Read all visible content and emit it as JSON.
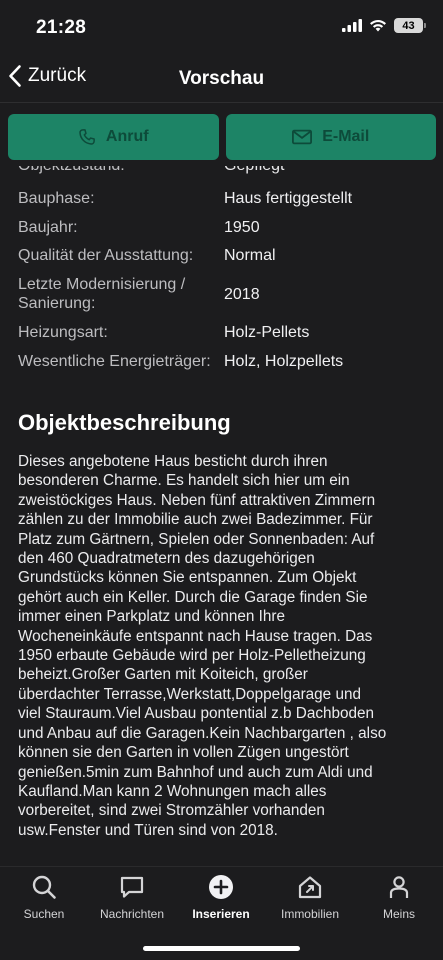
{
  "status": {
    "time": "21:28",
    "battery": "43"
  },
  "nav": {
    "back_label": "Zurück",
    "title": "Vorschau"
  },
  "actions": {
    "call_label": "Anruf",
    "email_label": "E-Mail"
  },
  "details_partial": {
    "label": "Objektzustand:",
    "value": "Gepflegt"
  },
  "details": [
    {
      "label": "Bauphase:",
      "value": "Haus fertiggestellt"
    },
    {
      "label": "Baujahr:",
      "value": "1950"
    },
    {
      "label": "Qualität der Ausstattung:",
      "value": "Normal"
    },
    {
      "label_line1": "Letzte Modernisierung /",
      "label_line2": "Sanierung:",
      "value": "2018"
    },
    {
      "label": "Heizungsart:",
      "value": "Holz-Pellets"
    },
    {
      "label": "Wesentliche Energieträger:",
      "value": "Holz, Holzpellets"
    }
  ],
  "description": {
    "title": "Objektbeschreibung",
    "lines": [
      "Dieses angebotene Haus besticht durch ihren",
      "besonderen Charme. Es handelt sich hier um ein",
      "zweistöckiges Haus. Neben fünf attraktiven Zimmern",
      "zählen zu der Immobilie auch zwei Badezimmer. Für",
      "Platz zum Gärtnern, Spielen oder Sonnenbaden: Auf",
      "den 460 Quadratmetern des dazugehörigen",
      "Grundstücks können Sie entspannen. Zum Objekt",
      "gehört auch ein Keller. Durch die Garage finden Sie",
      "immer einen Parkplatz und können Ihre",
      "Wocheneinkäufe entspannt nach Hause tragen. Das",
      "1950 erbaute Gebäude wird per Holz-Pelletheizung",
      "beheizt.Großer Garten mit Koiteich, großer",
      "überdachter Terrasse,Werkstatt,Doppelgarage und",
      "viel Stauraum.Viel Ausbau pontential z.b Dachboden",
      "und Anbau auf die Garagen.Kein Nachbargarten , also",
      "können sie den Garten in vollen Zügen ungestört",
      "genießen.5min zum Bahnhof und auch zum Aldi und",
      "Kaufland.Man kann 2 Wohnungen mach alles",
      "vorbereitet, sind zwei Stromzähler vorhanden",
      "usw.Fenster und Türen sind von 2018."
    ]
  },
  "tabs": [
    {
      "label": "Suchen",
      "icon": "search-icon"
    },
    {
      "label": "Nachrichten",
      "icon": "chat-icon"
    },
    {
      "label": "Inserieren",
      "icon": "add-circle-icon",
      "active": true
    },
    {
      "label": "Immobilien",
      "icon": "house-icon"
    },
    {
      "label": "Meins",
      "icon": "person-icon"
    }
  ],
  "colors": {
    "background": "#1c1c1e",
    "accent": "#1d8466",
    "accent_text": "#0d4b3a"
  }
}
